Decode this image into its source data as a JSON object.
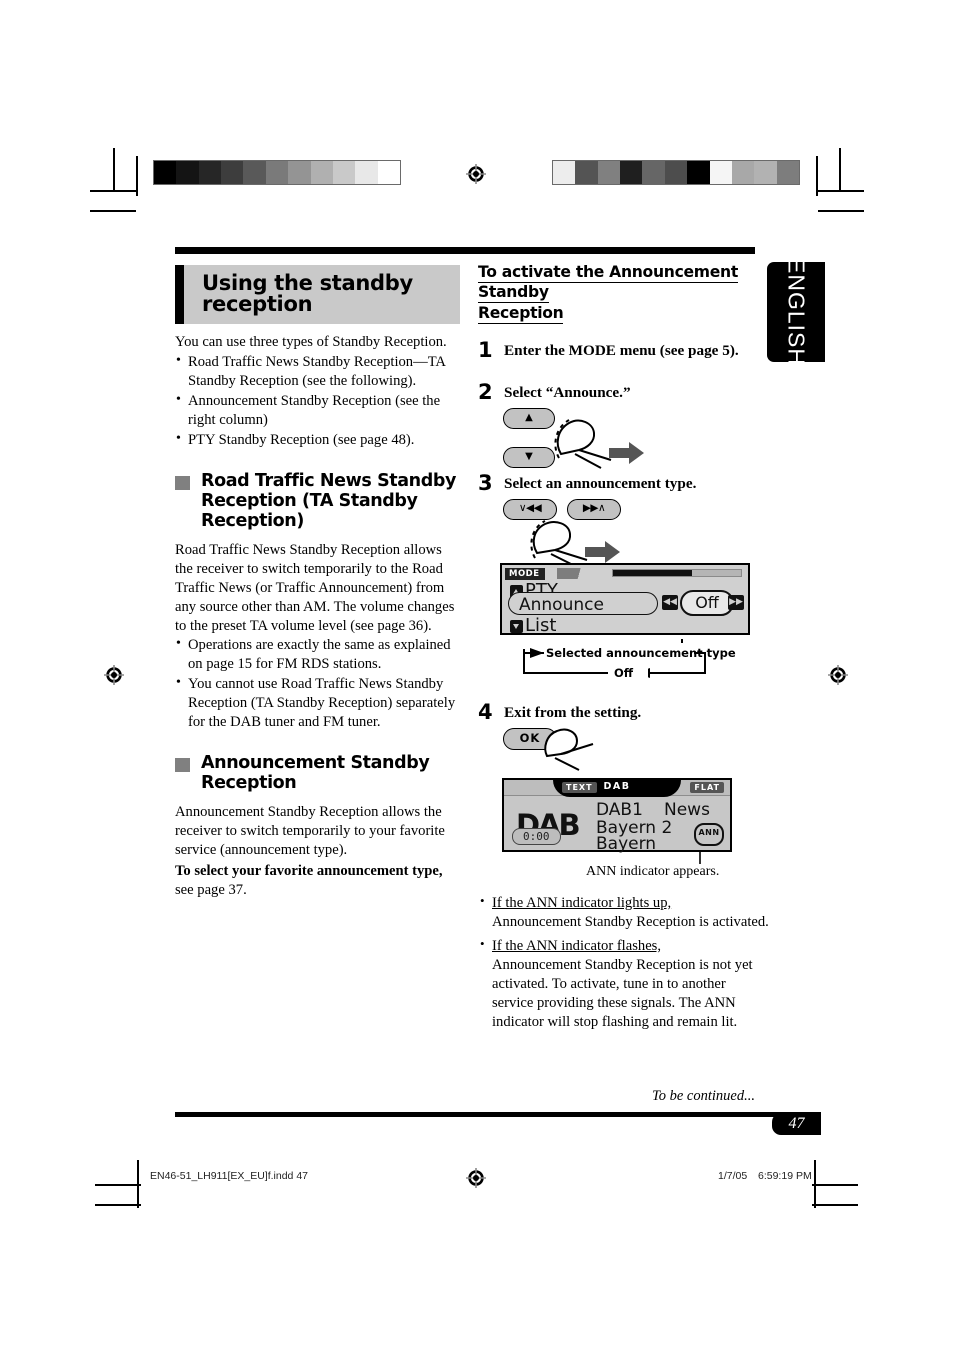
{
  "page": {
    "language_tab": "ENGLISH",
    "page_number": "47",
    "to_be_continued": "To be continued...",
    "footer_file": "EN46-51_LH911[EX_EU]f.indd   47",
    "footer_date": "1/7/05",
    "footer_time": "6:59:19 PM"
  },
  "left": {
    "title": "Using the standby reception",
    "intro": "You can use three types of Standby Reception.",
    "intro_bullets": [
      "Road Traffic News Standby Reception—TA Standby Reception (see the following).",
      "Announcement Standby Reception (see the right column)",
      "PTY Standby Reception (see page 48)."
    ],
    "section1": {
      "heading": "Road Traffic News Standby Reception (TA Standby Reception)",
      "body": "Road Traffic News Standby Reception allows the receiver to switch temporarily to the Road Traffic News (or Traffic Announcement) from any source other than AM. The volume changes to the preset TA volume level (see page 36).",
      "bullets": [
        "Operations are exactly the same as explained on page 15 for FM RDS stations.",
        "You cannot use Road Traffic News Standby Reception (TA Standby Reception) separately for the DAB tuner and FM tuner."
      ]
    },
    "section2": {
      "heading": "Announcement Standby Reception",
      "body": "Announcement Standby Reception allows the receiver to switch temporarily to your favorite service (announcement type).",
      "bold_lead": "To select your favorite announcement type,",
      "body_tail": " see page 37."
    }
  },
  "right": {
    "heading_line1": "To activate the Announcement Standby",
    "heading_line2": "Reception",
    "steps": [
      {
        "num": "1",
        "text": "Enter the MODE menu (see page 5)."
      },
      {
        "num": "2",
        "text": "Select “Announce.”"
      },
      {
        "num": "3",
        "text": "Select an announcement type."
      },
      {
        "num": "4",
        "text": "Exit from the setting."
      }
    ],
    "keys": {
      "up": "▲",
      "down": "▼",
      "seek_back": "∨◀◀",
      "seek_fwd": "▶▶∧",
      "ok": "OK"
    },
    "mode_display": {
      "tab_label": "MODE",
      "row_top": "PTY",
      "row_selected": "Announce",
      "row_bottom": "List",
      "value": "Off",
      "left_button": "◀◀",
      "right_button": "▶▶"
    },
    "flow_caption": {
      "top": "Selected announcement type",
      "bottom": "Off"
    },
    "dab_display": {
      "text_tag": "TEXT",
      "band_tag": "DAB",
      "eq_tag": "FLAT",
      "logo": "DAB",
      "time": "0:00",
      "ensemble": "DAB1",
      "pty": "News",
      "service": "Bayern 2",
      "service2": "Bayern",
      "indicator": "ANN"
    },
    "dab_caption": "ANN indicator appears.",
    "notes": [
      {
        "lead": "If the ANN indicator lights up,",
        "body": "Announcement Standby Reception is activated."
      },
      {
        "lead": "If the ANN indicator flashes,",
        "body": "Announcement Standby Reception is not yet activated. To activate, tune in to another service providing these signals. The ANN indicator will stop flashing and remain lit."
      }
    ]
  },
  "calibration": {
    "left_bar": [
      "#000000",
      "#141414",
      "#262626",
      "#3d3d3d",
      "#595959",
      "#7a7a7a",
      "#949494",
      "#b0b0b0",
      "#c9c9c9",
      "#e8e8e8",
      "#ffffff"
    ],
    "right_bar": [
      "#ededed",
      "#545454",
      "#808080",
      "#1f1f1f",
      "#666666",
      "#4d4d4d",
      "#000000",
      "#f5f5f5",
      "#a8a8a8",
      "#b2b2b2",
      "#7d7d7d"
    ]
  }
}
